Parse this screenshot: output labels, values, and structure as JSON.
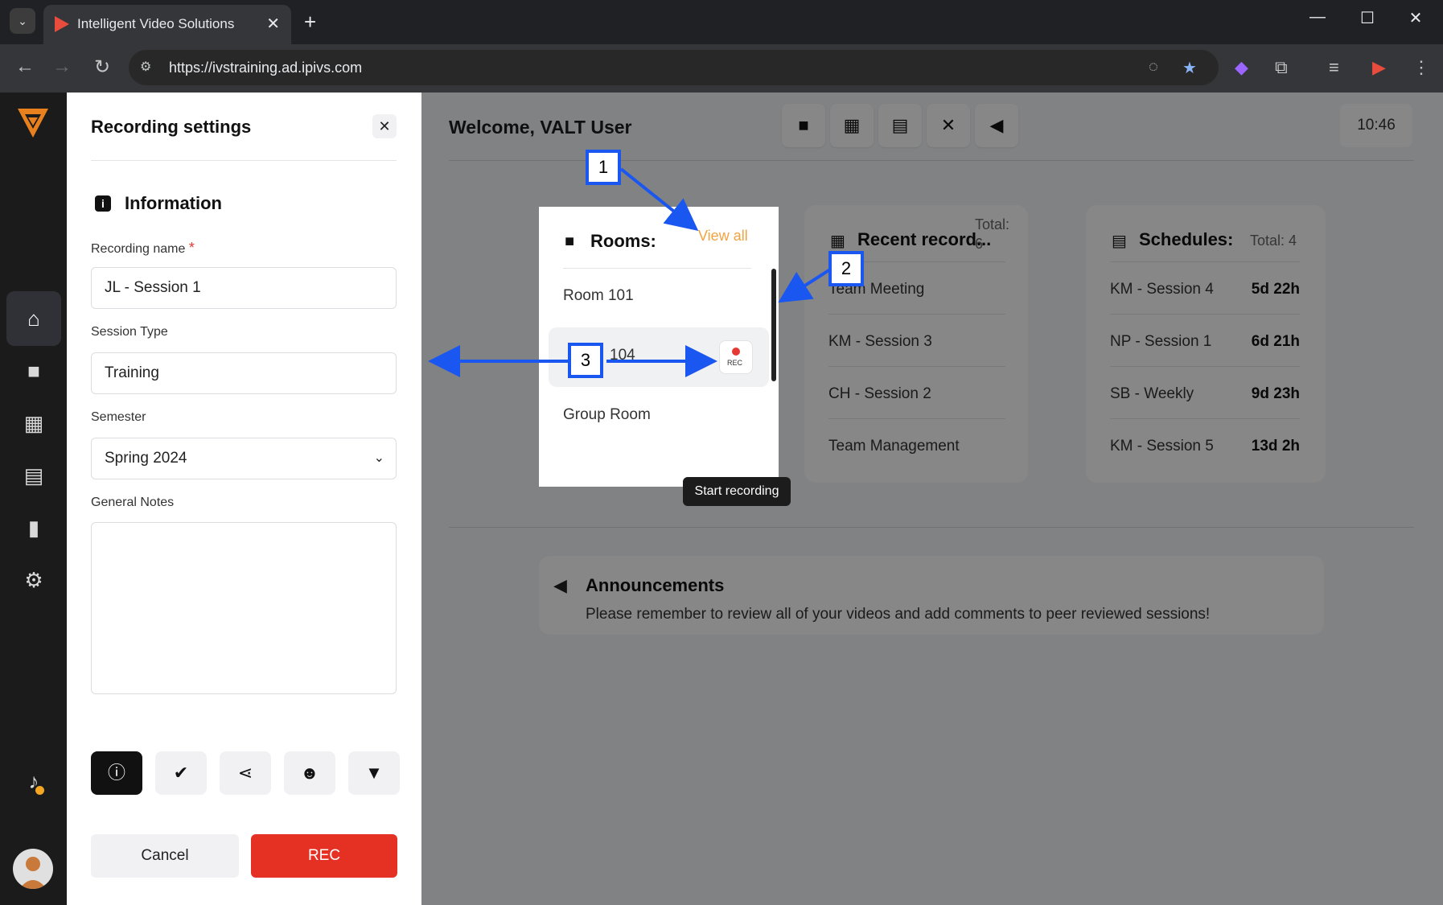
{
  "browser": {
    "tab_title": "Intelligent Video Solutions",
    "url": "https://ivstraining.ad.ipivs.com",
    "tab_close": "✕",
    "new_tab": "+",
    "minimize": "—",
    "maximize": "☐",
    "close": "✕"
  },
  "header": {
    "welcome": "Welcome, VALT User",
    "time": "10:46"
  },
  "rooms": {
    "title": "Rooms:",
    "view_all": "View all",
    "items": [
      "Room 101",
      "104",
      "Group Room"
    ],
    "rec_label": "REC",
    "tooltip": "Start recording"
  },
  "recent": {
    "title": "Recent record...",
    "total_label": "Total:",
    "total_value": "6",
    "items": [
      "Team Meeting",
      "KM - Session 3",
      "CH - Session 2",
      "Team Management"
    ]
  },
  "schedules": {
    "title": "Schedules:",
    "total": "Total: 4",
    "items": [
      {
        "name": "KM - Session 4",
        "time": "5d 22h"
      },
      {
        "name": "NP - Session 1",
        "time": "6d 21h"
      },
      {
        "name": "SB - Weekly",
        "time": "9d 23h"
      },
      {
        "name": "KM - Session 5",
        "time": "13d 2h"
      }
    ]
  },
  "announcements": {
    "title": "Announcements",
    "text": "Please remember to review all of your videos and add comments to peer reviewed sessions!"
  },
  "panel": {
    "title": "Recording settings",
    "close": "✕",
    "section": "Information",
    "recording_name_label": "Recording name",
    "required_mark": "*",
    "recording_name_value": "JL - Session 1",
    "session_type_label": "Session Type",
    "session_type_value": "Training",
    "semester_label": "Semester",
    "semester_value": "Spring 2024",
    "notes_label": "General Notes",
    "cancel": "Cancel",
    "rec": "REC"
  },
  "annotations": [
    "1",
    "2",
    "3"
  ],
  "colors": {
    "accent_orange": "#f3a340",
    "rec_red": "#e53124",
    "annotation_blue": "#1a56f0"
  }
}
